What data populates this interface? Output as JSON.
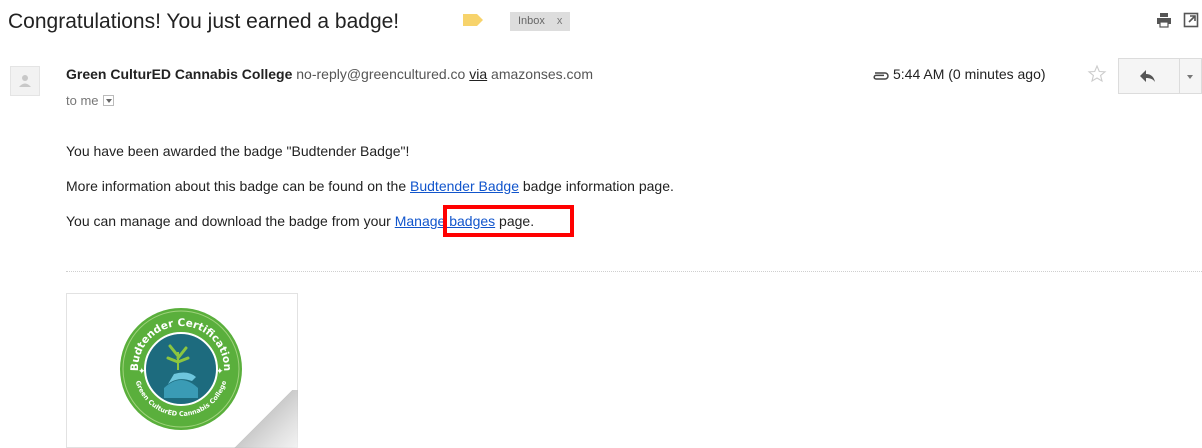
{
  "header": {
    "subject": "Congratulations! You just earned a badge!",
    "label_chip": "Inbox",
    "label_chip_close": "x"
  },
  "message": {
    "sender_name": "Green CulturED Cannabis College",
    "sender_email": "no-reply@greencultured.co",
    "via_word": "via",
    "via_domain": "amazonses.com",
    "to": "to me",
    "time": "5:44 AM (0 minutes ago)"
  },
  "body": {
    "line1": "You have been awarded the badge \"Budtender Badge\"!",
    "line2_before": "More information about this badge can be found on the ",
    "line2_link": "Budtender Badge",
    "line2_after": " badge information page.",
    "line3_before": "You can manage and download the badge from your ",
    "line3_link": "Manage badges",
    "line3_after": " page."
  },
  "attachment": {
    "badge_text_top": "Budtender Certification",
    "badge_text_bottom": "Green CulturED Cannabis College"
  },
  "colors": {
    "link": "#1155cc",
    "highlight": "#ff0000",
    "label_tag": "#f7d36b",
    "badge_ring": "#5aaf3c",
    "badge_center": "#1d6b7e"
  },
  "icons": {
    "print": "print-icon",
    "new_window": "new-window-icon",
    "attachment": "paperclip-icon",
    "star": "star-icon",
    "reply": "reply-icon",
    "more": "chevron-down-icon"
  }
}
